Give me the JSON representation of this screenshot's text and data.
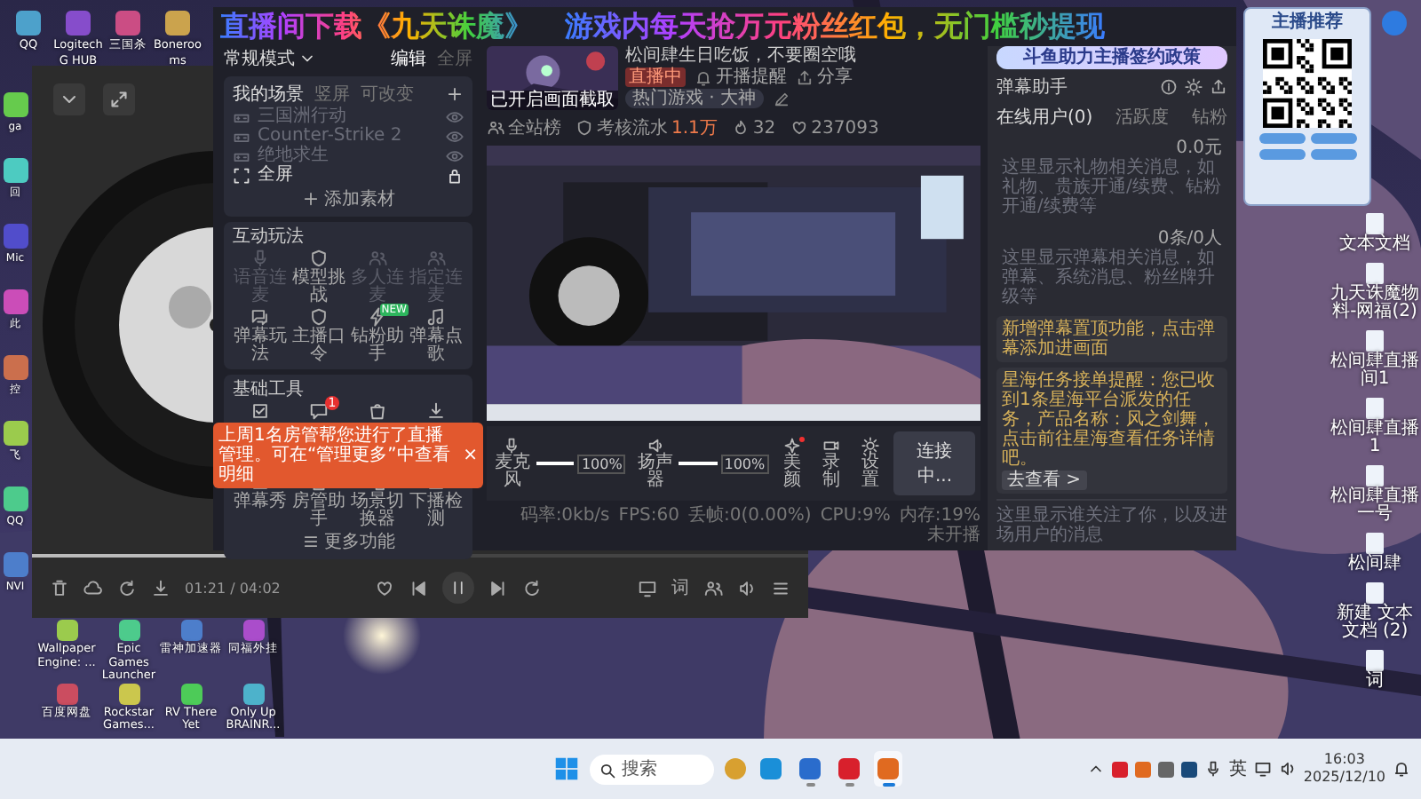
{
  "overlay_banner": {
    "parts": [
      "直播间下载《九天诛魔》",
      "游戏内每天抢万元粉丝红包，无门槛秒提现"
    ]
  },
  "recommend_card": {
    "title": "主播推荐"
  },
  "desktop_icons": {
    "top_row": [
      {
        "label": "QQ"
      },
      {
        "label": "Logitech G HUB"
      },
      {
        "label": "三国杀"
      },
      {
        "label": "Bonerooms"
      }
    ],
    "left_column": [
      {
        "label": "ga"
      },
      {
        "label": "回"
      },
      {
        "label": "Mic"
      },
      {
        "label": "此"
      },
      {
        "label": "控"
      },
      {
        "label": "飞"
      },
      {
        "label": "QQ"
      },
      {
        "label": "NVI"
      }
    ],
    "bottom_grid": [
      {
        "label": "Wallpaper Engine: ..."
      },
      {
        "label": "Epic Games Launcher"
      },
      {
        "label": "雷神加速器"
      },
      {
        "label": "同福外挂"
      },
      {
        "label": "百度网盘"
      },
      {
        "label": "Rockstar Games..."
      },
      {
        "label": "RV There Yet"
      },
      {
        "label": "Only Up BRAINR..."
      }
    ],
    "right_column": [
      {
        "label": "文本文档"
      },
      {
        "label": "九天诛魔物料-网福(2)"
      },
      {
        "label": "松间肆直播间1"
      },
      {
        "label": "松间肆直播1"
      },
      {
        "label": "松间肆直播一号"
      },
      {
        "label": "松间肆"
      },
      {
        "label": "新建 文本文档 (2)"
      },
      {
        "label": "词"
      }
    ]
  },
  "music_player": {
    "time": "01:21 / 04:02",
    "progress": {
      "level": 0.34
    },
    "playing": true,
    "lyrics_button": "词"
  },
  "stream_app": {
    "mode": "常规模式",
    "header_actions": [
      {
        "label": "编辑",
        "disabled": false
      },
      {
        "label": "全屏",
        "disabled": true
      }
    ],
    "scene_tabs": [
      {
        "label": "我的场景",
        "selected": true
      },
      {
        "label": "竖屏",
        "selected": false
      },
      {
        "label": "可改变",
        "selected": false
      }
    ],
    "scenes": [
      {
        "name": "三国洲行动",
        "hidden": true,
        "locked": false
      },
      {
        "name": "Counter-Strike 2",
        "hidden": true,
        "locked": false
      },
      {
        "name": "绝地求生",
        "hidden": true,
        "locked": false
      },
      {
        "name": "全屏",
        "hidden": false,
        "locked": true
      }
    ],
    "add_source": "添加素材",
    "interaction": {
      "title": "互动玩法",
      "items": [
        {
          "label": "语音连麦",
          "disabled": true
        },
        {
          "label": "模型挑战",
          "disabled": false
        },
        {
          "label": "多人连麦",
          "disabled": true
        },
        {
          "label": "指定连麦",
          "disabled": true
        },
        {
          "label": "弹幕玩法",
          "disabled": false
        },
        {
          "label": "主播口令",
          "disabled": false
        },
        {
          "label": "钻粉助手",
          "disabled": false,
          "badge": "NEW"
        },
        {
          "label": "弹幕点歌",
          "disabled": false
        }
      ]
    },
    "tools": {
      "title": "基础工具",
      "items": [
        {
          "kind": "covered"
        },
        {
          "kind": "covered",
          "badge": "1"
        },
        {
          "kind": "covered"
        },
        {
          "kind": "covered"
        },
        {
          "kind": "labeled",
          "label": "弹幕秀"
        },
        {
          "kind": "labeled",
          "label": "房管助手"
        },
        {
          "kind": "labeled",
          "label": "场景切换器"
        },
        {
          "kind": "labeled",
          "label": "下播检测"
        }
      ],
      "more": "更多功能"
    },
    "toast": {
      "text": "上周1名房管帮您进行了直播管理。可在“管理更多”中查看明细",
      "close": "×"
    },
    "live_info": {
      "thumbnail_text": "已开启画面截取",
      "title": "松间肆生日吃饭，不要圈空哦",
      "status": "直播中",
      "actions": [
        "开播提醒",
        "分享"
      ],
      "category": "热门游戏 · 大神",
      "stats": [
        {
          "kind": "rank",
          "text": "全站榜"
        },
        {
          "kind": "flow",
          "text": "考核流水",
          "value": "1.1万"
        },
        {
          "kind": "hot",
          "text": "32"
        },
        {
          "kind": "fans",
          "text": "237093"
        }
      ]
    },
    "audio": [
      {
        "kind": "mic",
        "label": "麦克风",
        "level": 1,
        "reading": "100%"
      },
      {
        "kind": "speaker",
        "label": "扬声器",
        "level": 1,
        "reading": "100%"
      }
    ],
    "tool_buttons": [
      {
        "kind": "beauty",
        "label": "美颜",
        "dot": true
      },
      {
        "kind": "record",
        "label": "录制",
        "dot": false
      },
      {
        "kind": "settings",
        "label": "设置",
        "dot": false
      }
    ],
    "connect_button": "连接中...",
    "status_bar": [
      "码率:0kb/s",
      "FPS:60",
      "丢帧:0(0.00%)",
      "CPU:9%",
      "内存:19%",
      "未开播"
    ],
    "danmu": {
      "promo": "斗鱼助力主播签约政策",
      "title": "弹幕助手",
      "tabs": [
        {
          "label": "在线用户(0)",
          "selected": true
        },
        {
          "label": "活跃度",
          "selected": false
        },
        {
          "label": "钻粉",
          "selected": false
        }
      ],
      "messages": [
        {
          "kind": "info",
          "text": "这里显示礼物相关消息，如礼物、贵族开通/续费、钻粉开通/续费等",
          "stat": "0.0元"
        },
        {
          "kind": "info",
          "text": "这里显示弹幕相关消息，如弹幕、系统消息、粉丝牌升级等",
          "stat": "0条/0人"
        },
        {
          "kind": "notice",
          "text": "新增弹幕置顶功能，点击弹幕添加进画面"
        },
        {
          "kind": "notice",
          "text": "星海任务接单提醒：您已收到1条星海平台派发的任务，产品名称：风之剑舞，点击前往星海查看任务详情吧。",
          "action": "去查看 >"
        }
      ],
      "follow_hint": "这里显示谁关注了你，以及进场用户的消息"
    }
  },
  "taskbar": {
    "search_placeholder": "搜索",
    "apps": [
      {
        "running": false,
        "active": false
      },
      {
        "running": true,
        "active": false
      },
      {
        "running": true,
        "active": false
      },
      {
        "running": true,
        "active": true
      }
    ],
    "tray": {
      "ime": "英",
      "time": "16:03",
      "date": "2025/12/10"
    }
  }
}
